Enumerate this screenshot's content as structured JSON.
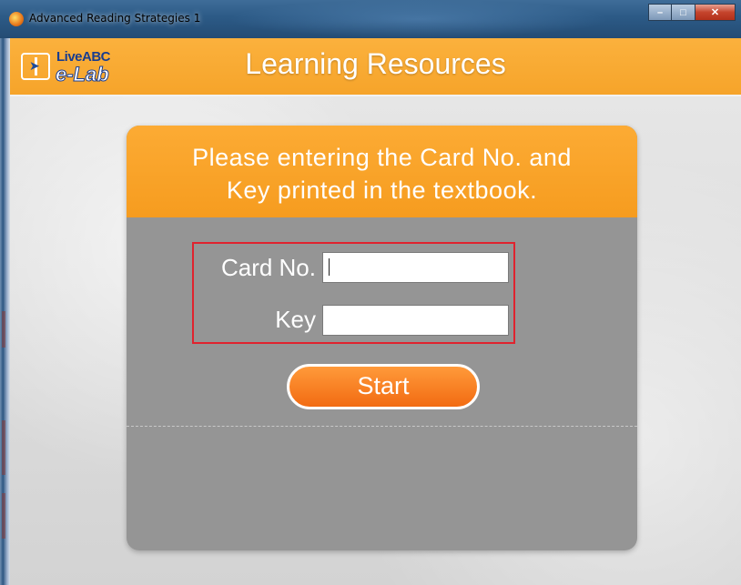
{
  "window": {
    "title": "Advanced Reading Strategies 1",
    "buttons": {
      "minimize": "–",
      "maximize": "□",
      "close": "✕"
    }
  },
  "header": {
    "logo_brand_prefix": "Live",
    "logo_brand_suffix": "ABC",
    "logo_sub": "e-Lab",
    "title": "Learning Resources"
  },
  "dialog": {
    "message_line1": "Please entering the Card No. and",
    "message_line2": "Key printed in the textbook.",
    "card_label": "Card No.",
    "card_value": "",
    "key_label": "Key",
    "key_value": "",
    "start_label": "Start"
  },
  "colors": {
    "accent_orange": "#f6a42a",
    "panel_gray": "#959595",
    "highlight_red": "#e0232e",
    "button_orange": "#f26b12"
  },
  "icons": [
    "app-icon",
    "book-cursor-logo-icon"
  ]
}
